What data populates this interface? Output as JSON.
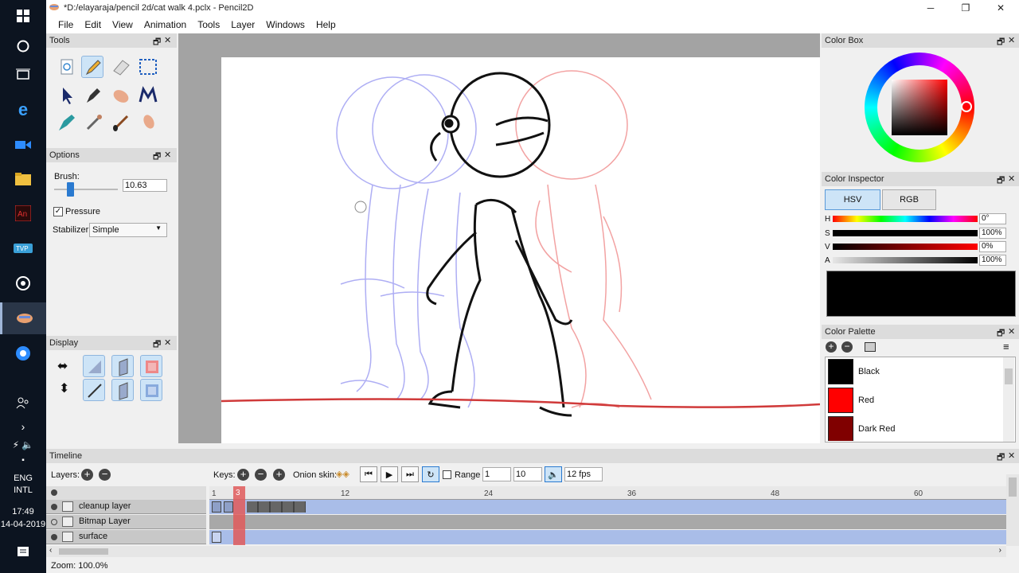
{
  "window": {
    "title": "*D:/elayaraja/pencil 2d/cat walk 4.pclx - Pencil2D",
    "minimize": "─",
    "maximize": "❐",
    "close": "✕"
  },
  "menu": [
    "File",
    "Edit",
    "View",
    "Animation",
    "Tools",
    "Layer",
    "Windows",
    "Help"
  ],
  "taskbar": {
    "lang": "ENG",
    "layout": "INTL",
    "time": "17:49",
    "date": "14-04-2019"
  },
  "panels": {
    "tools_title": "Tools",
    "options_title": "Options",
    "display_title": "Display",
    "colorbox_title": "Color Box",
    "inspector_title": "Color Inspector",
    "palette_title": "Color Palette",
    "timeline_title": "Timeline"
  },
  "options": {
    "brush_label": "Brush:",
    "brush_value": "10.63",
    "brush_fraction": 0.25,
    "pressure_label": "Pressure",
    "pressure_checked": true,
    "stabilizer_label": "Stabilizer",
    "stabilizer_value": "Simple"
  },
  "inspector": {
    "hsv_tab": "HSV",
    "rgb_tab": "RGB",
    "h_label": "H",
    "s_label": "S",
    "v_label": "V",
    "a_label": "A",
    "h_value": "0°",
    "s_value": "100%",
    "v_value": "0%",
    "a_value": "100%",
    "current_color": "#000000"
  },
  "palette": {
    "items": [
      {
        "name": "Black",
        "color": "#000000"
      },
      {
        "name": "Red",
        "color": "#ff0000"
      },
      {
        "name": "Dark Red",
        "color": "#800000"
      }
    ]
  },
  "timeline": {
    "layers_label": "Layers:",
    "keys_label": "Keys:",
    "onion_label": "Onion skin:",
    "range_label": "Range",
    "range_start": "1",
    "range_end": "10",
    "fps": "12 fps",
    "current_frame": "3",
    "ruler": [
      "1",
      "12",
      "24",
      "36",
      "48",
      "60"
    ],
    "layers": [
      {
        "name": "cleanup layer"
      },
      {
        "name": "Bitmap Layer"
      },
      {
        "name": "surface"
      }
    ]
  },
  "status": {
    "zoom": "Zoom: 100.0%"
  },
  "colors": {
    "accent": "#cde4f7",
    "timeline_track": "#a9bde8",
    "playhead": "#e05a5a"
  }
}
